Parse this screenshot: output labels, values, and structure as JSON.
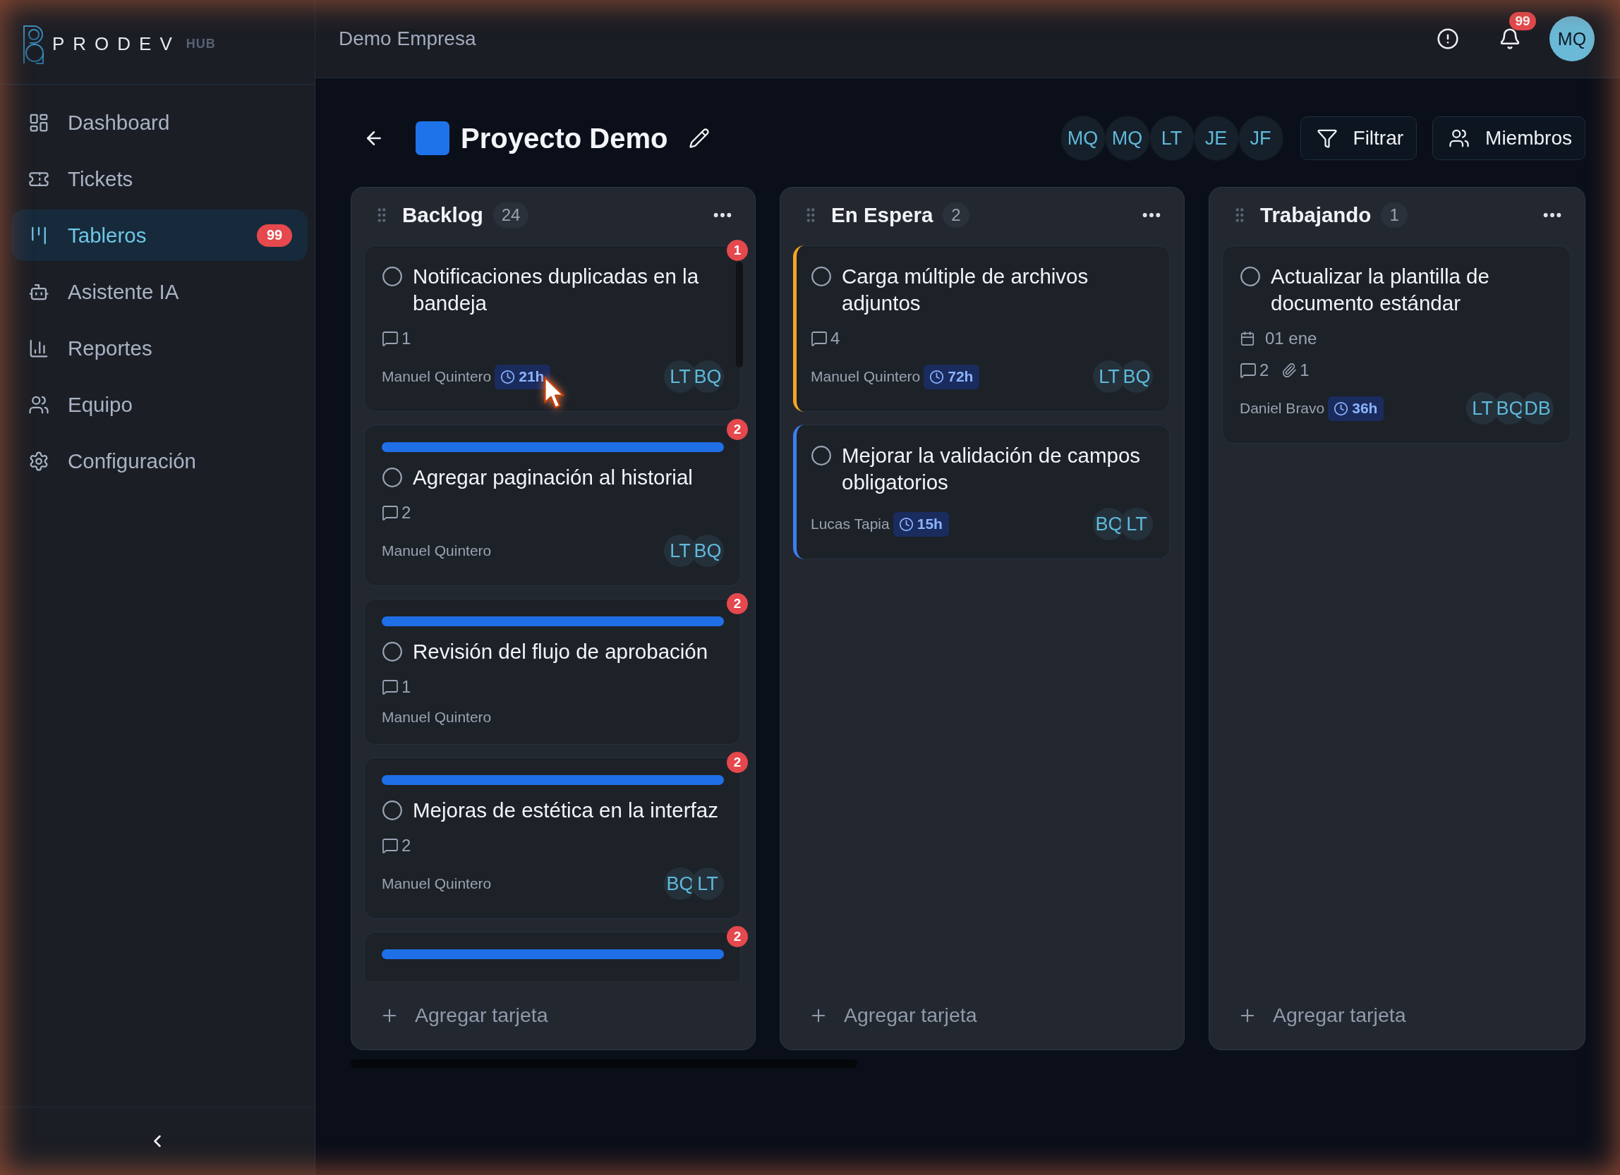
{
  "sidebar": {
    "logo": {
      "name": "PRODEV",
      "suffix": "HUB"
    },
    "items": [
      {
        "label": "Dashboard",
        "selected": false
      },
      {
        "label": "Tickets",
        "selected": false
      },
      {
        "label": "Tableros",
        "selected": true,
        "badge": "99"
      },
      {
        "label": "Asistente IA",
        "selected": false
      },
      {
        "label": "Reportes",
        "selected": false
      },
      {
        "label": "Equipo",
        "selected": false
      },
      {
        "label": "Configuración",
        "selected": false
      }
    ]
  },
  "header": {
    "company": "Demo Empresa",
    "notifications": "99",
    "user": "MQ"
  },
  "project": {
    "title": "Proyecto Demo",
    "members": [
      "MQ",
      "MQ",
      "LT",
      "JE",
      "JF"
    ],
    "buttons": [
      "Filtrar",
      "Miembros"
    ]
  },
  "columns": [
    {
      "title": "Backlog",
      "count": "24",
      "add_label": "Agregar tarjeta",
      "cards": [
        {
          "title": "Notificaciones duplicadas en la bandeja",
          "checked": false,
          "badge": "1",
          "label_bar": false,
          "comments": "1",
          "assignee": "Manuel Quintero",
          "time": "21h",
          "avatars": [
            "LT",
            "BQ"
          ]
        },
        {
          "title": "Agregar paginación al historial",
          "checked": false,
          "badge": "2",
          "label_bar": true,
          "comments": "2",
          "assignee": "Manuel Quintero",
          "avatars": [
            "LT",
            "BQ"
          ]
        },
        {
          "title": "Revisión del flujo de aprobación",
          "checked": false,
          "badge": "2",
          "label_bar": true,
          "comments": "1",
          "assignee": "Manuel Quintero"
        },
        {
          "title": "Mejoras de estética en la interfaz",
          "checked": false,
          "badge": "2",
          "label_bar": true,
          "comments": "2",
          "assignee": "Manuel Quintero",
          "avatars": [
            "BQ",
            "LT"
          ]
        },
        {
          "badge": "2",
          "label_bar": true
        }
      ]
    },
    {
      "title": "En Espera",
      "count": "2",
      "add_label": "Agregar tarjeta",
      "cards": [
        {
          "title": "Carga múltiple de archivos adjuntos",
          "checked": false,
          "color": "#f5a524",
          "label_bar": false,
          "comments": "4",
          "assignee": "Manuel Quintero",
          "time": "72h",
          "avatars": [
            "LT",
            "BQ"
          ]
        },
        {
          "title": "Mejorar la validación de campos obligatorios",
          "checked": false,
          "color": "#3b7ff0",
          "label_bar": false,
          "assignee": "Lucas Tapia",
          "time": "15h",
          "avatars": [
            "BQ",
            "LT"
          ]
        }
      ]
    },
    {
      "title": "Trabajando",
      "count": "1",
      "add_label": "Agregar tarjeta",
      "cards": [
        {
          "title": "Actualizar la plantilla de documento estándar",
          "checked": false,
          "label_bar": false,
          "due": "01 ene",
          "comments": "2",
          "attachments": "1",
          "assignee": "Daniel Bravo",
          "time": "36h",
          "avatars": [
            "LT",
            "BQ",
            "DB"
          ]
        }
      ]
    }
  ]
}
